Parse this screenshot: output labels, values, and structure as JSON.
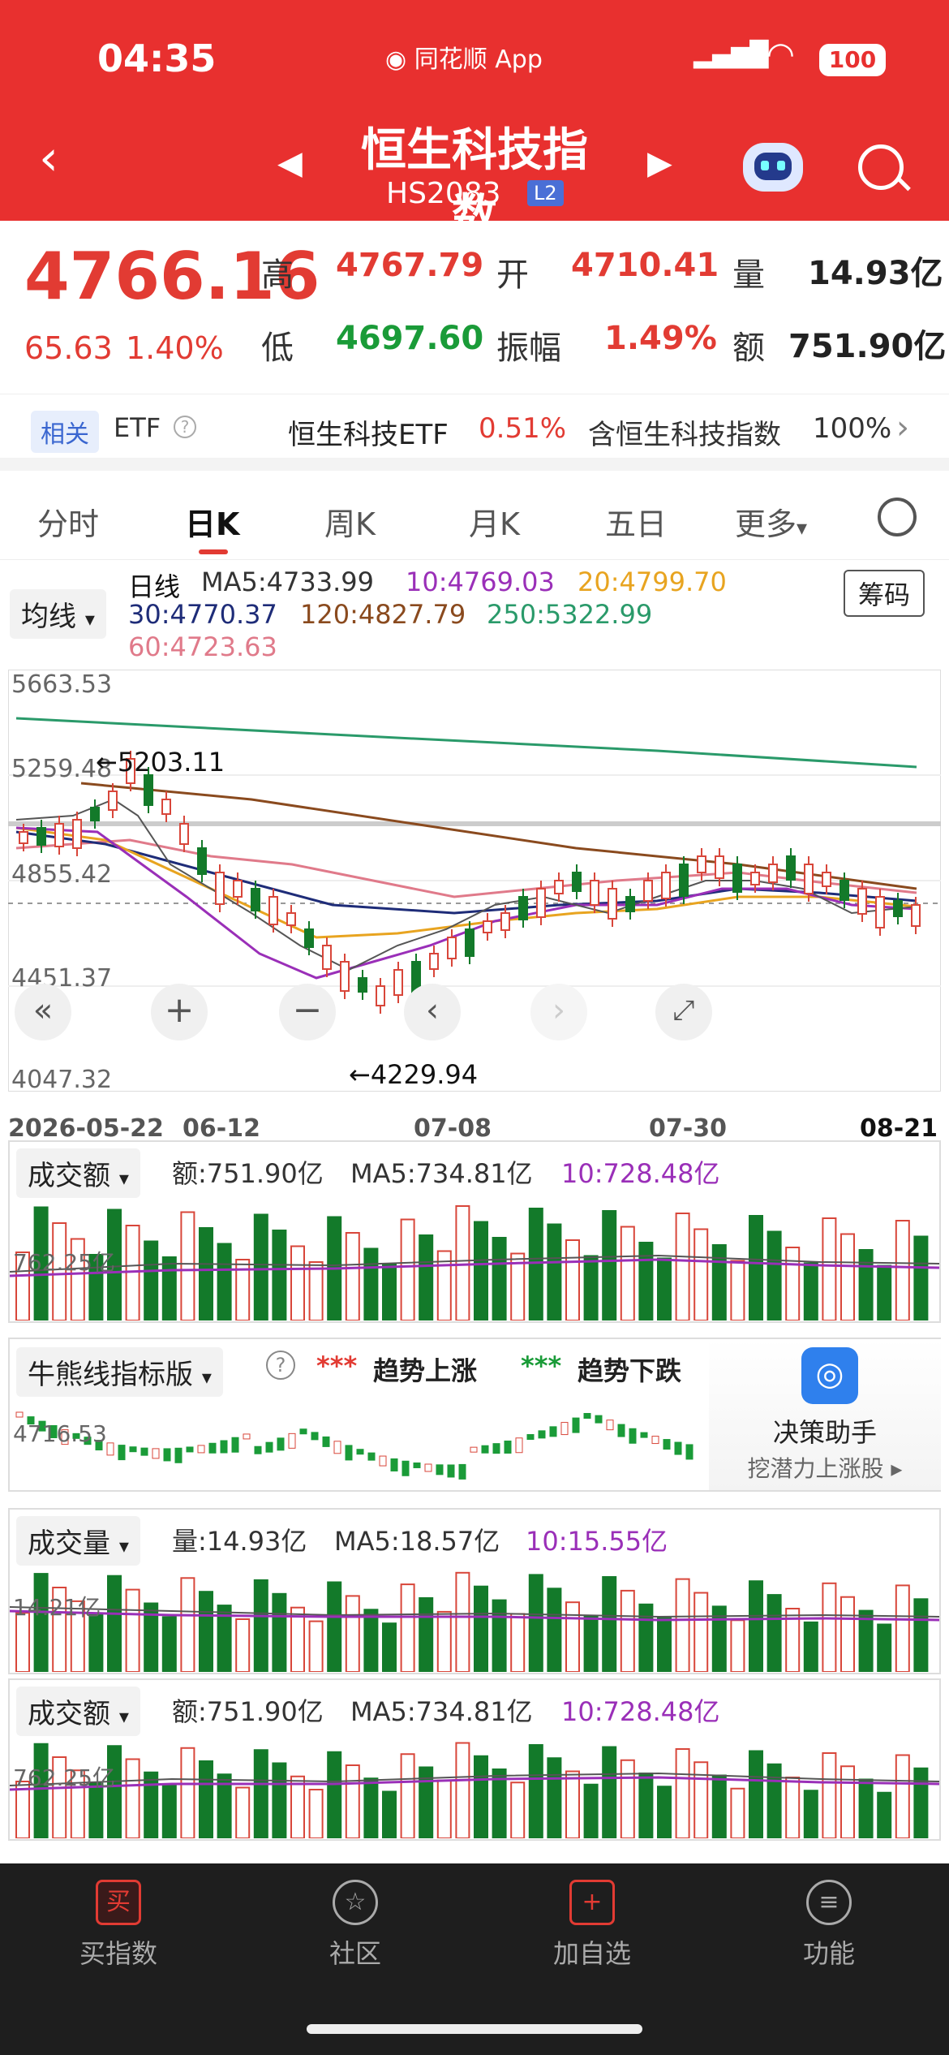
{
  "status_bar": {
    "time": "04:35",
    "source": "同花顺 App",
    "battery": "100"
  },
  "header": {
    "title": "恒生科技指数",
    "code": "HS2083",
    "level": "L2"
  },
  "quote": {
    "price": "4766.16",
    "change": "65.63",
    "change_pct": "1.40%",
    "high_label": "高",
    "high": "4767.79",
    "open_label": "开",
    "open": "4710.41",
    "vol_label": "量",
    "vol": "14.93亿",
    "low_label": "低",
    "low": "4697.60",
    "amp_label": "振幅",
    "amp": "1.49%",
    "amt_label": "额",
    "amt": "751.90亿"
  },
  "related": {
    "tag": "相关",
    "etf": "ETF",
    "etf_name": "恒生科技ETF",
    "etf_pct": "0.51%",
    "holding": "含恒生科技指数",
    "holding_pct": "100%"
  },
  "tabs": [
    {
      "label": "分时"
    },
    {
      "label": "日K"
    },
    {
      "label": "周K"
    },
    {
      "label": "月K"
    },
    {
      "label": "五日"
    },
    {
      "label": "更多"
    }
  ],
  "kline": {
    "ma_select": "均线",
    "period": "日线",
    "ma5": "MA5:4733.99",
    "ma10": "10:4769.03",
    "ma20": "20:4799.70",
    "ma30": "30:4770.37",
    "ma120": "120:4827.79",
    "ma250": "250:5322.99",
    "ma60": "60:4723.63",
    "chip_btn": "筹码",
    "y_top": "5663.53",
    "y_1": "5259.48",
    "y_2": "4855.42",
    "y_3": "4451.37",
    "y_bottom": "4047.32",
    "max_mark": "←5203.11",
    "min_mark": "←4229.94",
    "dates": [
      "2026-05-22",
      "06-12",
      "07-08",
      "07-30",
      "08-21"
    ]
  },
  "amount_panel": {
    "select": "成交额",
    "amt": "额:751.90亿",
    "ma5": "MA5:734.81亿",
    "ma10": "10:728.48亿",
    "axis": "762.25亿"
  },
  "bullbear_panel": {
    "select": "牛熊线指标版",
    "up_marks": "***",
    "up_label": "趋势上涨",
    "down_marks": "***",
    "down_label": "趋势下跌",
    "axis": "4716.53",
    "assistant_title": "决策助手",
    "assistant_sub": "挖潜力上涨股"
  },
  "volume_panel": {
    "select": "成交量",
    "vol": "量:14.93亿",
    "ma5": "MA5:18.57亿",
    "ma10": "10:15.55亿",
    "axis": "14.21亿"
  },
  "amount_panel2": {
    "select": "成交额",
    "amt": "额:751.90亿",
    "ma5": "MA5:734.81亿",
    "ma10": "10:728.48亿",
    "axis": "762.25亿"
  },
  "nav": [
    {
      "label": "买指数",
      "icon": "买"
    },
    {
      "label": "社区",
      "icon": "☆"
    },
    {
      "label": "加自选",
      "icon": "+"
    },
    {
      "label": "功能",
      "icon": "≡"
    }
  ]
}
